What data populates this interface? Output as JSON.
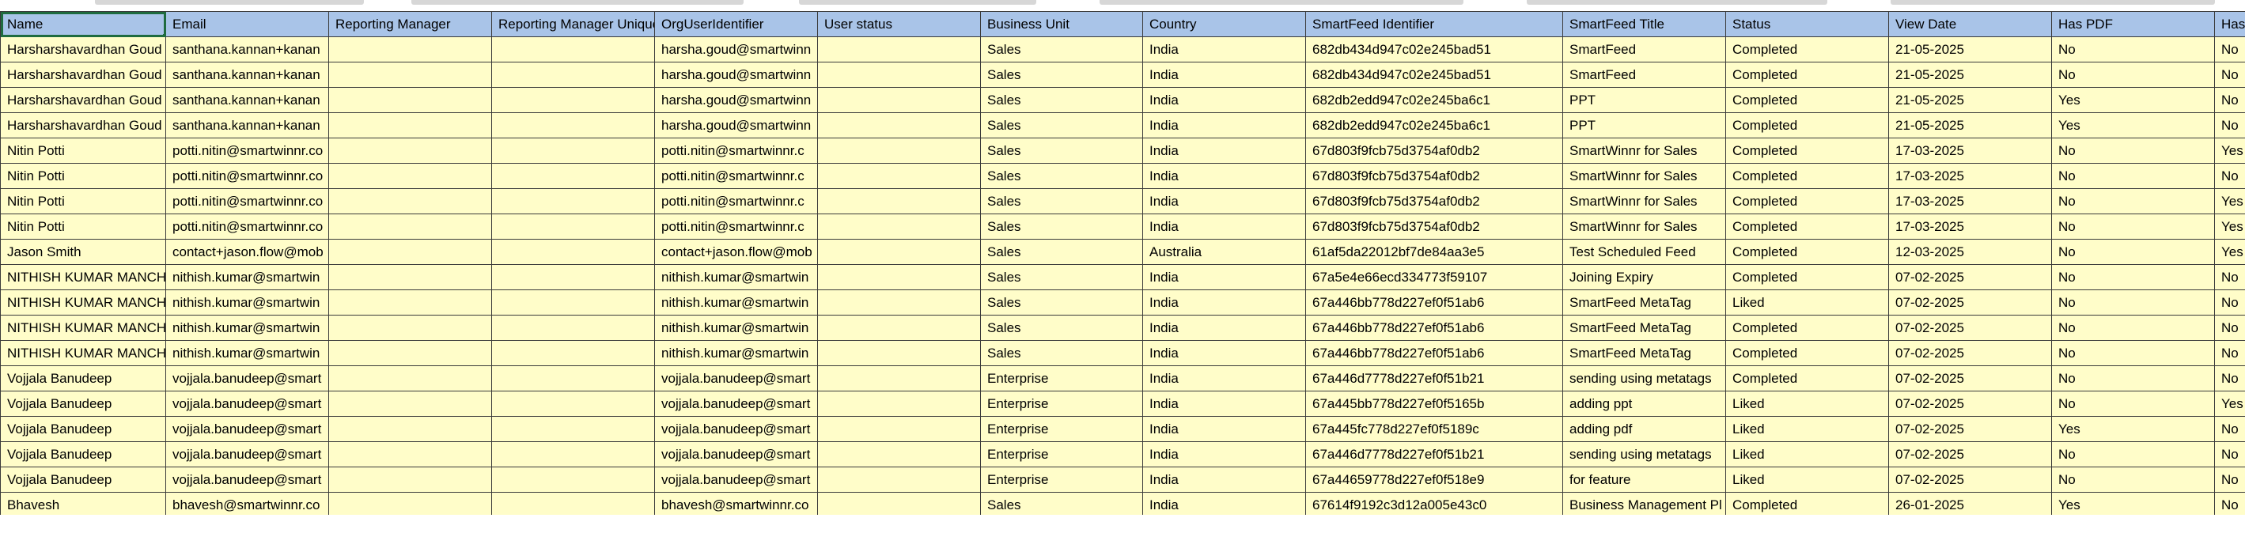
{
  "sheet": {
    "headers": [
      "Name",
      "Email",
      "Reporting Manager",
      "Reporting Manager Unique",
      "OrgUserIdentifier",
      "User status",
      "Business Unit",
      "Country",
      "SmartFeed Identifier",
      "SmartFeed Title",
      "Status",
      "View Date",
      "Has PDF",
      "Has"
    ],
    "rows": [
      [
        "Harsharshavardhan Goud",
        "santhana.kannan+kanan",
        "",
        "",
        "harsha.goud@smartwinn",
        "",
        "Sales",
        "India",
        "682db434d947c02e245bad51",
        "SmartFeed",
        "Completed",
        "21-05-2025",
        "No",
        "No"
      ],
      [
        "Harsharshavardhan Goud",
        "santhana.kannan+kanan",
        "",
        "",
        "harsha.goud@smartwinn",
        "",
        "Sales",
        "India",
        "682db434d947c02e245bad51",
        "SmartFeed",
        "Completed",
        "21-05-2025",
        "No",
        "No"
      ],
      [
        "Harsharshavardhan Goud",
        "santhana.kannan+kanan",
        "",
        "",
        "harsha.goud@smartwinn",
        "",
        "Sales",
        "India",
        "682db2edd947c02e245ba6c1",
        "PPT",
        "Completed",
        "21-05-2025",
        "Yes",
        "No"
      ],
      [
        "Harsharshavardhan Goud",
        "santhana.kannan+kanan",
        "",
        "",
        "harsha.goud@smartwinn",
        "",
        "Sales",
        "India",
        "682db2edd947c02e245ba6c1",
        "PPT",
        "Completed",
        "21-05-2025",
        "Yes",
        "No"
      ],
      [
        "Nitin Potti",
        "potti.nitin@smartwinnr.co",
        "",
        "",
        "potti.nitin@smartwinnr.c",
        "",
        "Sales",
        "India",
        "67d803f9fcb75d3754af0db2",
        "SmartWinnr for Sales",
        "Completed",
        "17-03-2025",
        "No",
        "Yes"
      ],
      [
        "Nitin Potti",
        "potti.nitin@smartwinnr.co",
        "",
        "",
        "potti.nitin@smartwinnr.c",
        "",
        "Sales",
        "India",
        "67d803f9fcb75d3754af0db2",
        "SmartWinnr for Sales",
        "Completed",
        "17-03-2025",
        "No",
        "No"
      ],
      [
        "Nitin Potti",
        "potti.nitin@smartwinnr.co",
        "",
        "",
        "potti.nitin@smartwinnr.c",
        "",
        "Sales",
        "India",
        "67d803f9fcb75d3754af0db2",
        "SmartWinnr for Sales",
        "Completed",
        "17-03-2025",
        "No",
        "Yes"
      ],
      [
        "Nitin Potti",
        "potti.nitin@smartwinnr.co",
        "",
        "",
        "potti.nitin@smartwinnr.c",
        "",
        "Sales",
        "India",
        "67d803f9fcb75d3754af0db2",
        "SmartWinnr for Sales",
        "Completed",
        "17-03-2025",
        "No",
        "Yes"
      ],
      [
        "Jason Smith",
        "contact+jason.flow@mob",
        "",
        "",
        "contact+jason.flow@mob",
        "",
        "Sales",
        "Australia",
        "61af5da22012bf7de84aa3e5",
        "Test Scheduled Feed",
        "Completed",
        "12-03-2025",
        "No",
        "Yes"
      ],
      [
        "NITHISH KUMAR MANCH",
        "nithish.kumar@smartwin",
        "",
        "",
        "nithish.kumar@smartwin",
        "",
        "Sales",
        "India",
        "67a5e4e66ecd334773f59107",
        "Joining Expiry",
        "Completed",
        "07-02-2025",
        "No",
        "No"
      ],
      [
        "NITHISH KUMAR MANCH",
        "nithish.kumar@smartwin",
        "",
        "",
        "nithish.kumar@smartwin",
        "",
        "Sales",
        "India",
        "67a446bb778d227ef0f51ab6",
        "SmartFeed MetaTag",
        "Liked",
        "07-02-2025",
        "No",
        "No"
      ],
      [
        "NITHISH KUMAR MANCH",
        "nithish.kumar@smartwin",
        "",
        "",
        "nithish.kumar@smartwin",
        "",
        "Sales",
        "India",
        "67a446bb778d227ef0f51ab6",
        "SmartFeed MetaTag",
        "Completed",
        "07-02-2025",
        "No",
        "No"
      ],
      [
        "NITHISH KUMAR MANCH",
        "nithish.kumar@smartwin",
        "",
        "",
        "nithish.kumar@smartwin",
        "",
        "Sales",
        "India",
        "67a446bb778d227ef0f51ab6",
        "SmartFeed MetaTag",
        "Completed",
        "07-02-2025",
        "No",
        "No"
      ],
      [
        "Vojjala Banudeep",
        "vojjala.banudeep@smart",
        "",
        "",
        "vojjala.banudeep@smart",
        "",
        "Enterprise",
        "India",
        "67a446d7778d227ef0f51b21",
        "sending using metatags",
        "Completed",
        "07-02-2025",
        "No",
        "No"
      ],
      [
        "Vojjala Banudeep",
        "vojjala.banudeep@smart",
        "",
        "",
        "vojjala.banudeep@smart",
        "",
        "Enterprise",
        "India",
        "67a445bb778d227ef0f5165b",
        "adding ppt",
        "Liked",
        "07-02-2025",
        "No",
        "Yes"
      ],
      [
        "Vojjala Banudeep",
        "vojjala.banudeep@smart",
        "",
        "",
        "vojjala.banudeep@smart",
        "",
        "Enterprise",
        "India",
        "67a445fc778d227ef0f5189c",
        "adding pdf",
        "Liked",
        "07-02-2025",
        "Yes",
        "No"
      ],
      [
        "Vojjala Banudeep",
        "vojjala.banudeep@smart",
        "",
        "",
        "vojjala.banudeep@smart",
        "",
        "Enterprise",
        "India",
        "67a446d7778d227ef0f51b21",
        "sending using metatags",
        "Liked",
        "07-02-2025",
        "No",
        "No"
      ],
      [
        "Vojjala Banudeep",
        "vojjala.banudeep@smart",
        "",
        "",
        "vojjala.banudeep@smart",
        "",
        "Enterprise",
        "India",
        "67a44659778d227ef0f518e9",
        "for feature",
        "Liked",
        "07-02-2025",
        "No",
        "No"
      ],
      [
        "Bhavesh",
        "bhavesh@smartwinnr.co",
        "",
        "",
        "bhavesh@smartwinnr.co",
        "",
        "Sales",
        "India",
        "67614f9192c3d12a005e43c0",
        "Business Management Pl",
        "Completed",
        "26-01-2025",
        "Yes",
        "No"
      ]
    ]
  }
}
